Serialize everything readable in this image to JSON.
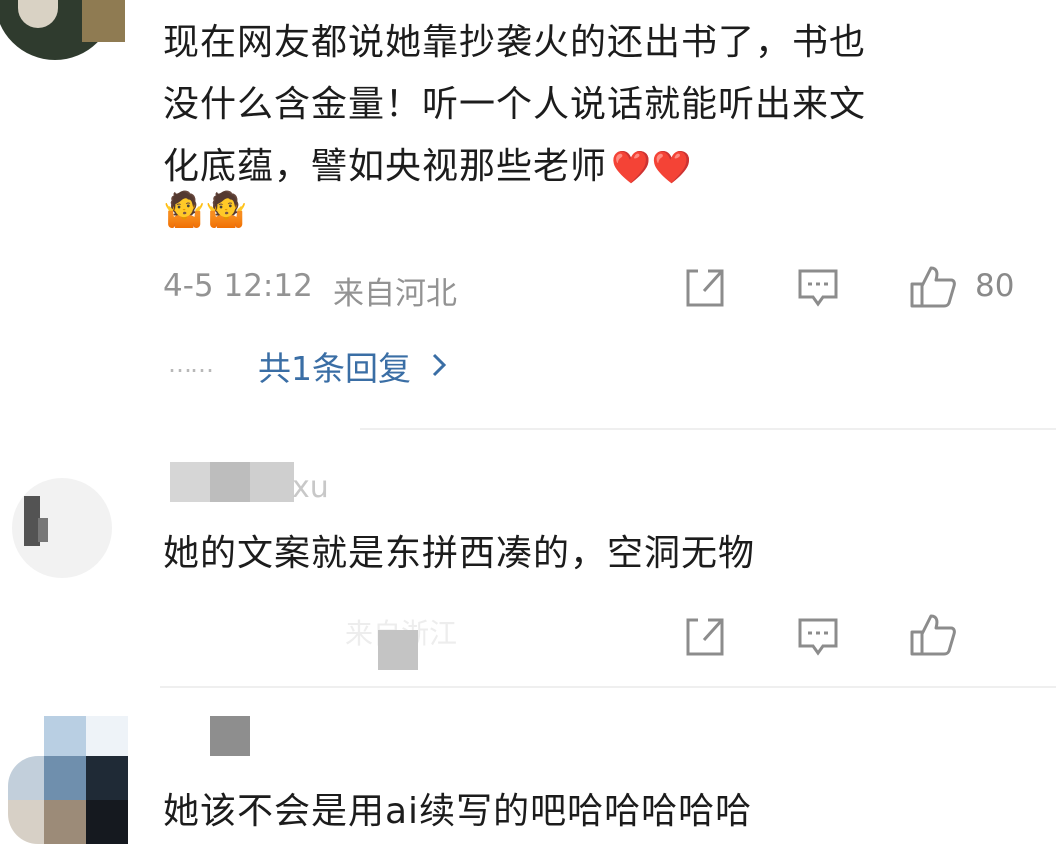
{
  "comments": [
    {
      "text_lines": [
        "现在网友都说她靠抄袭火的还出书了，书也",
        "没什么含金量！听一个人说话就能听出来文",
        "化底蕴，譬如央视那些老师"
      ],
      "emoji_hearts": "❤️❤️",
      "emoji_shrug": "🤷🤷",
      "time": "4-5 12:12",
      "location": "来自河北",
      "like_count": "80",
      "replies_label": "共1条回复",
      "replies_dots": "……",
      "chevron": "›"
    },
    {
      "username": "xu",
      "text": "她的文案就是东拼西凑的，空洞无物",
      "location_partial": "来自浙江"
    },
    {
      "text": "她该不会是用ai续写的吧哈哈哈哈哈"
    }
  ],
  "icons": {
    "share": "share-icon",
    "comment": "comment-icon",
    "like": "thumbs-up-icon",
    "reply_chevron": "chevron-right-icon"
  },
  "colors": {
    "link_blue": "#3a6ea5",
    "meta_gray": "#939393",
    "icon_gray": "#8c8c8c",
    "mosaic_gray": "#c9c9c9"
  }
}
